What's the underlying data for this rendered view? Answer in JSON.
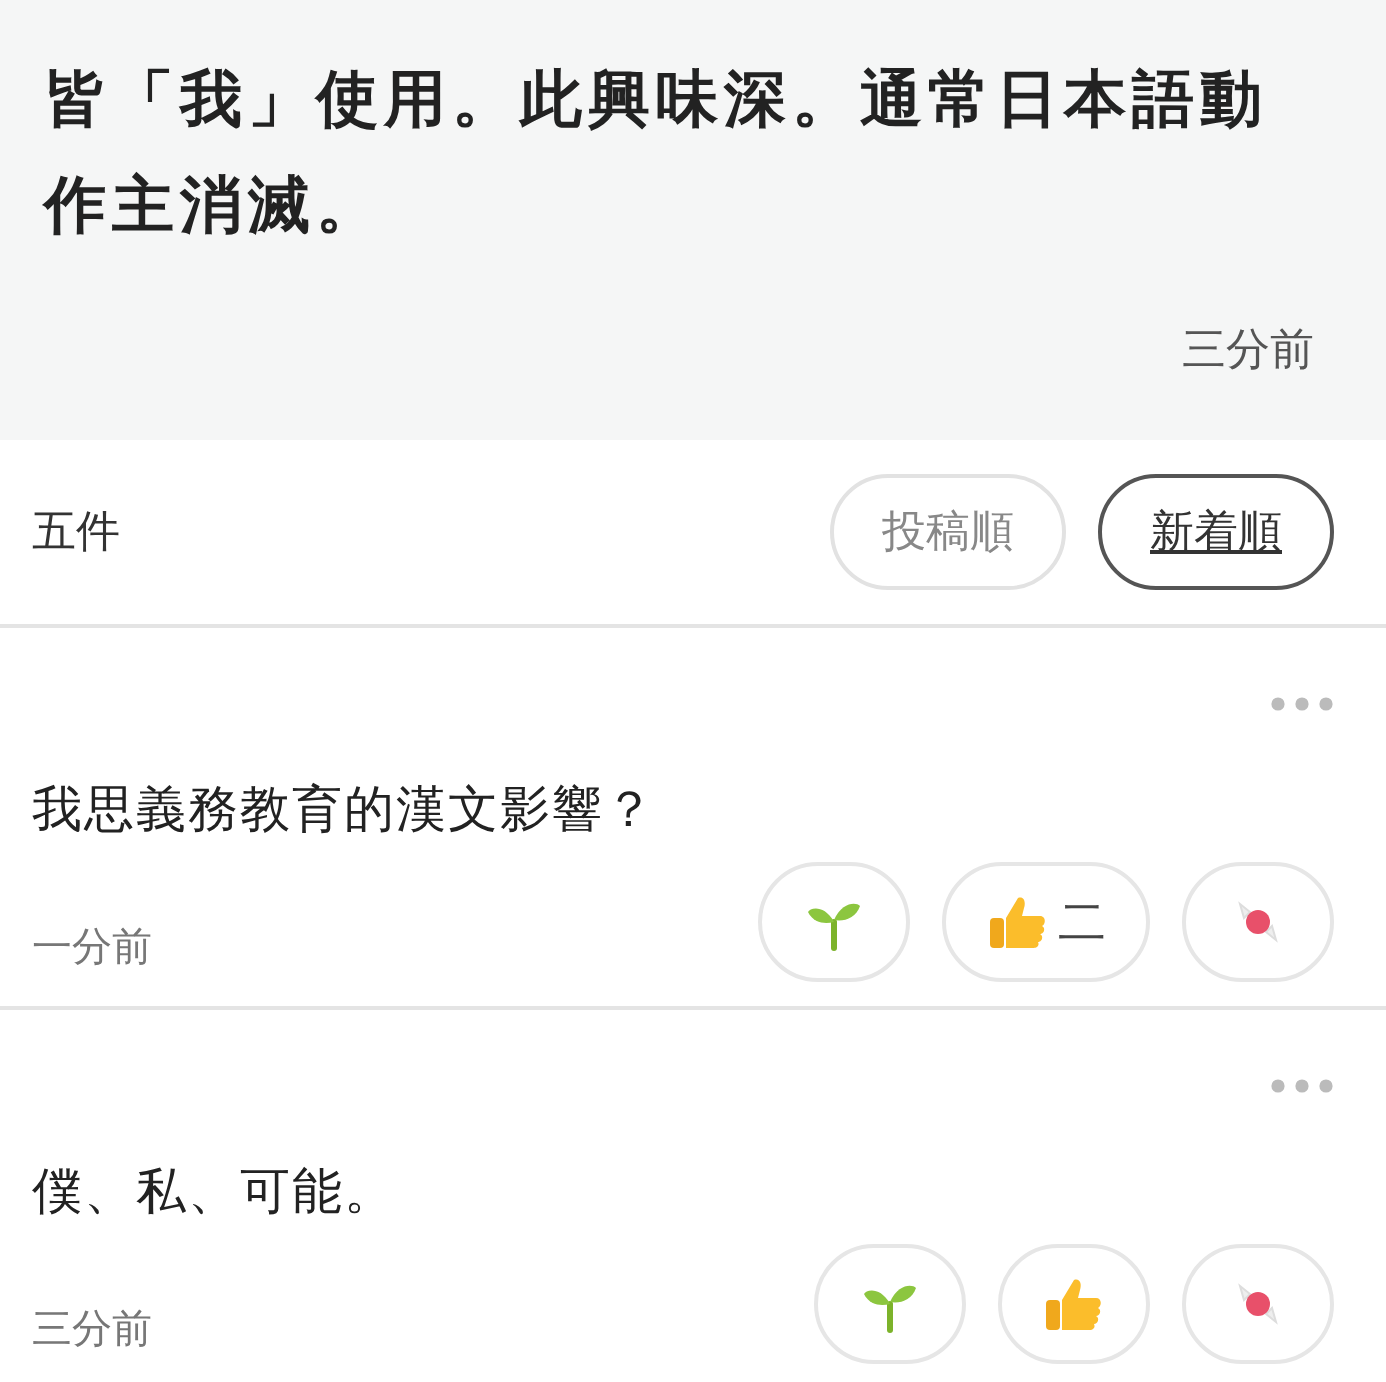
{
  "post": {
    "text": "皆「我」使用。此興味深。通常日本語動作主消滅。",
    "time": "三分前"
  },
  "sort_bar": {
    "count": "五件",
    "options": [
      {
        "label": "投稿順",
        "selected": false
      },
      {
        "label": "新着順",
        "selected": true
      }
    ]
  },
  "comments": [
    {
      "text": "我思義務教育的漢文影響？",
      "time": "一分前",
      "reactions": [
        {
          "kind": "sprout"
        },
        {
          "kind": "thumb",
          "count": "二"
        },
        {
          "kind": "candy"
        }
      ]
    },
    {
      "text": "僕、私、可能。",
      "time": "三分前",
      "reactions": [
        {
          "kind": "sprout"
        },
        {
          "kind": "thumb"
        },
        {
          "kind": "candy"
        }
      ]
    }
  ]
}
